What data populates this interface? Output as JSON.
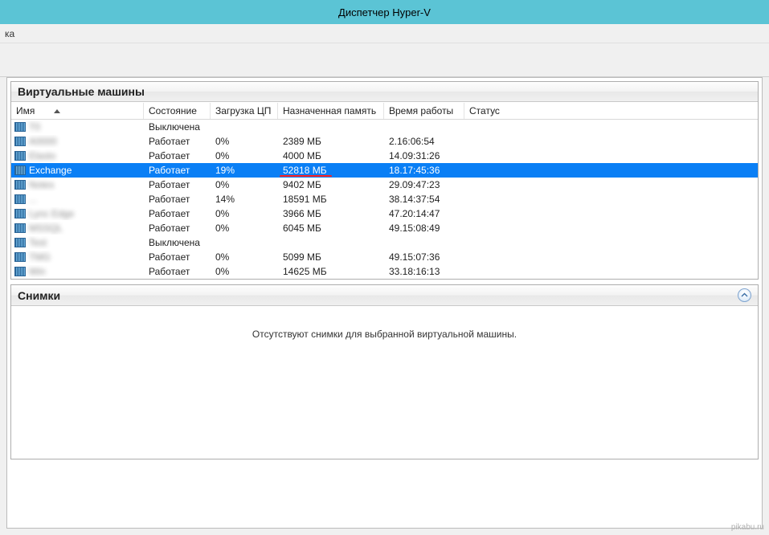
{
  "window": {
    "title": "Диспетчер Hyper-V"
  },
  "menubar": {
    "item": "ка"
  },
  "vm_panel": {
    "title": "Виртуальные машины",
    "columns": {
      "name": "Имя",
      "state": "Состояние",
      "cpu": "Загрузка ЦП",
      "memory": "Назначенная память",
      "uptime": "Время работы",
      "status": "Статус"
    },
    "rows": [
      {
        "name": "T0",
        "blurred": true,
        "state": "Выключена",
        "cpu": "",
        "memory": "",
        "uptime": "",
        "selected": false
      },
      {
        "name": "A0000",
        "blurred": true,
        "state": "Работает",
        "cpu": "0%",
        "memory": "2389 МБ",
        "uptime": "2.16:06:54",
        "selected": false
      },
      {
        "name": "Elasto",
        "blurred": true,
        "state": "Работает",
        "cpu": "0%",
        "memory": "4000 МБ",
        "uptime": "14.09:31:26",
        "selected": false
      },
      {
        "name": "Exchange",
        "blurred": false,
        "state": "Работает",
        "cpu": "19%",
        "memory": "52818 МБ",
        "uptime": "18.17:45:36",
        "selected": true,
        "highlight_memory": true
      },
      {
        "name": "Notes",
        "blurred": true,
        "state": "Работает",
        "cpu": "0%",
        "memory": "9402 МБ",
        "uptime": "29.09:47:23",
        "selected": false
      },
      {
        "name": "...",
        "blurred": true,
        "state": "Работает",
        "cpu": "14%",
        "memory": "18591 МБ",
        "uptime": "38.14:37:54",
        "selected": false
      },
      {
        "name": "Lync Edge",
        "blurred": true,
        "state": "Работает",
        "cpu": "0%",
        "memory": "3966 МБ",
        "uptime": "47.20:14:47",
        "selected": false
      },
      {
        "name": "MSSQL",
        "blurred": true,
        "state": "Работает",
        "cpu": "0%",
        "memory": "6045 МБ",
        "uptime": "49.15:08:49",
        "selected": false
      },
      {
        "name": "Test",
        "blurred": true,
        "state": "Выключена",
        "cpu": "",
        "memory": "",
        "uptime": "",
        "selected": false
      },
      {
        "name": "TMG",
        "blurred": true,
        "state": "Работает",
        "cpu": "0%",
        "memory": "5099 МБ",
        "uptime": "49.15:07:36",
        "selected": false
      },
      {
        "name": "Win",
        "blurred": true,
        "state": "Работает",
        "cpu": "0%",
        "memory": "14625 МБ",
        "uptime": "33.18:16:13",
        "selected": false
      }
    ]
  },
  "snapshots_panel": {
    "title": "Снимки",
    "empty_text": "Отсутствуют снимки для выбранной виртуальной машины."
  },
  "watermark": "pikabu.ru"
}
